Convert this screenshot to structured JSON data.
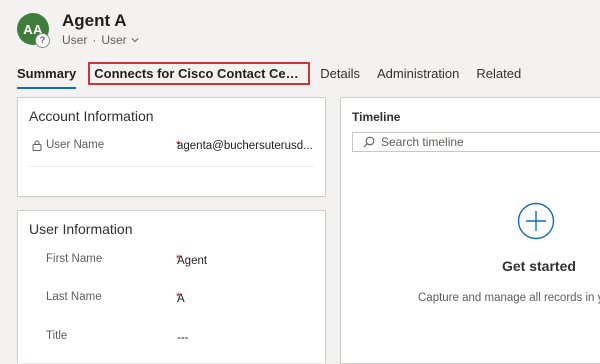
{
  "header": {
    "avatar_initials": "AA",
    "presence_symbol": "?",
    "title": "Agent A",
    "subtitle_entity": "User",
    "subtitle_form": "User"
  },
  "tabs": [
    {
      "label": "Summary"
    },
    {
      "label": "Connects for Cisco Contact Center ..."
    },
    {
      "label": "Details"
    },
    {
      "label": "Administration"
    },
    {
      "label": "Related"
    }
  ],
  "account_info": {
    "title": "Account Information",
    "fields": [
      {
        "label": "User Name",
        "required": "*",
        "value": "agenta@buchersuterusd..."
      }
    ]
  },
  "user_info": {
    "title": "User Information",
    "fields": [
      {
        "label": "First Name",
        "required": "*",
        "value": "Agent"
      },
      {
        "label": "Last Name",
        "required": "*",
        "value": "A"
      },
      {
        "label": "Title",
        "required": "",
        "value": "---"
      }
    ]
  },
  "timeline": {
    "title": "Timeline",
    "search_placeholder": "Search timeline",
    "empty_heading": "Get started",
    "empty_description": "Capture and manage all records in yo"
  },
  "colors": {
    "avatar": "#3f7e3a",
    "accent": "#0f6cbd",
    "highlight_box": "#d13438",
    "required": "#c50f1f"
  }
}
